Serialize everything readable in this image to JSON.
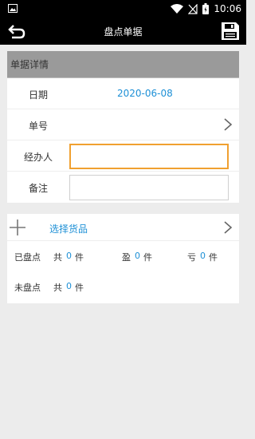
{
  "status_bar": {
    "time": "10:06",
    "icons": [
      "image-icon",
      "wifi-icon",
      "no-signal-icon",
      "battery-icon"
    ]
  },
  "app_bar": {
    "title": "盘点单据",
    "icons": [
      "back-icon",
      "save-icon"
    ]
  },
  "details": {
    "section_title": "单据详情",
    "date_label": "日期",
    "date_value": "2020-06-08",
    "number_label": "单号",
    "handler_label": "经办人",
    "handler_value": "",
    "note_label": "备注",
    "note_value": ""
  },
  "goods": {
    "select_label": "选择货品",
    "counted": {
      "label": "已盘点",
      "total_prefix": "共",
      "total": "0",
      "unit": "件"
    },
    "surplus": {
      "label": "盈",
      "count": "0",
      "unit": "件"
    },
    "loss": {
      "label": "亏",
      "count": "0",
      "unit": "件"
    },
    "uncounted": {
      "label": "未盘点",
      "total_prefix": "共",
      "total": "0",
      "unit": "件"
    }
  },
  "colors": {
    "accent_blue": "#1e90d6",
    "focus_orange": "#f0a030",
    "section_header_gray": "#9a9a9a"
  }
}
